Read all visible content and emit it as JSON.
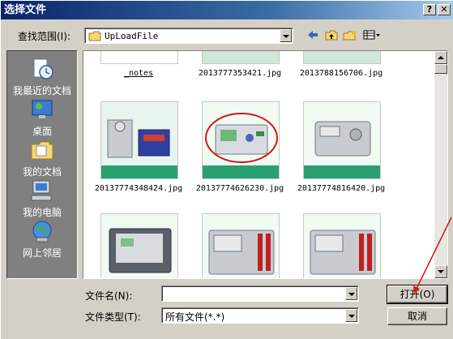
{
  "window": {
    "title": "选择文件",
    "help_label": "?",
    "close_label": "✕"
  },
  "lookin": {
    "label": "查找范围(I):",
    "value": "UpLoadFile"
  },
  "toolbar": {
    "icons": [
      "back-arrow-icon",
      "up-folder-icon",
      "new-folder-icon",
      "view-menu-icon"
    ]
  },
  "sidebar": {
    "items": [
      {
        "label": "我最近的文档",
        "icon": "recent-documents-icon"
      },
      {
        "label": "桌面",
        "icon": "desktop-icon"
      },
      {
        "label": "我的文档",
        "icon": "my-documents-icon"
      },
      {
        "label": "我的电脑",
        "icon": "my-computer-icon"
      },
      {
        "label": "网上邻居",
        "icon": "network-icon"
      }
    ]
  },
  "files": {
    "row1": [
      "_notes",
      "2013777353421.jpg",
      "2013788156706.jpg"
    ],
    "row2": [
      "20137774348424.jpg",
      "20137774626230.jpg",
      "20137774816420.jpg"
    ],
    "row3": [
      "",
      "",
      ""
    ]
  },
  "colors": {
    "accent_title": "#0a246a",
    "highlight_circle": "#d01818",
    "sidebar_bg": "#808080"
  },
  "filename": {
    "label": "文件名(N):",
    "value": ""
  },
  "filetype": {
    "label": "文件类型(T):",
    "value": "所有文件(*.*)"
  },
  "buttons": {
    "open": "打开(O)",
    "cancel": "取消"
  }
}
